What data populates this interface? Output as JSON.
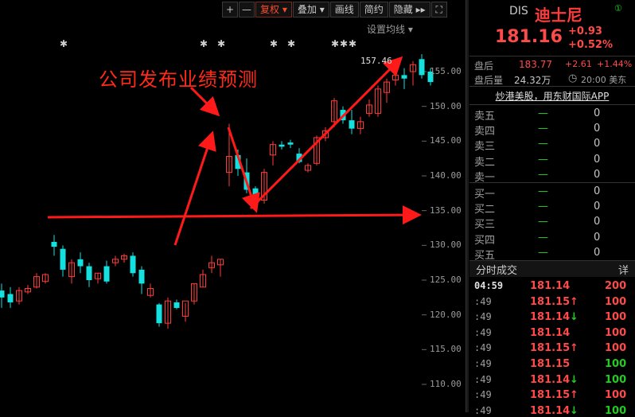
{
  "toolbar": {
    "plus": "+",
    "minus": "—",
    "adjust": "复权",
    "overlay": "叠加",
    "draw": "画线",
    "simple": "简约",
    "hide": "隐藏",
    "dropdown_arrow": "▾",
    "expand_arrow": "▸▸",
    "fullscreen": "⛶"
  },
  "ma_setting": "设置均线 ▾",
  "annotation": "公司发布业绩预测",
  "peak_label": "157.46",
  "chart_data": {
    "type": "candlestick",
    "title": "",
    "ylim": [
      107,
      158.5
    ],
    "y_ticks": [
      "155.00",
      "150.00",
      "145.00",
      "140.00",
      "135.00",
      "130.00",
      "125.00",
      "120.00",
      "115.00",
      "110.00"
    ],
    "candles": [
      {
        "o": 123.5,
        "h": 124.5,
        "c": 122.5,
        "l": 121.0
      },
      {
        "o": 123.0,
        "h": 124.0,
        "c": 121.8,
        "l": 121.0
      },
      {
        "o": 122.0,
        "h": 124.0,
        "c": 123.5,
        "l": 121.5
      },
      {
        "o": 123.3,
        "h": 124.3,
        "c": 123.8,
        "l": 123.0
      },
      {
        "o": 124.0,
        "h": 126.0,
        "c": 125.5,
        "l": 123.8
      },
      {
        "o": 124.8,
        "h": 126.0,
        "c": 125.8,
        "l": 124.5
      },
      {
        "o": 130.5,
        "h": 131.5,
        "c": 129.8,
        "l": 128.5
      },
      {
        "o": 129.5,
        "h": 130.0,
        "c": 126.5,
        "l": 125.5
      },
      {
        "o": 125.5,
        "h": 128.0,
        "c": 127.5,
        "l": 124.5
      },
      {
        "o": 128.0,
        "h": 129.0,
        "c": 127.0,
        "l": 126.0
      },
      {
        "o": 127.0,
        "h": 127.5,
        "c": 125.0,
        "l": 124.0
      },
      {
        "o": 125.2,
        "h": 126.0,
        "c": 126.0,
        "l": 124.5
      },
      {
        "o": 127.0,
        "h": 127.8,
        "c": 124.8,
        "l": 124.5
      },
      {
        "o": 127.5,
        "h": 128.5,
        "c": 128.0,
        "l": 127.0
      },
      {
        "o": 128.0,
        "h": 128.8,
        "c": 128.5,
        "l": 127.5
      },
      {
        "o": 128.5,
        "h": 129.0,
        "c": 126.0,
        "l": 125.5
      },
      {
        "o": 126.5,
        "h": 127.0,
        "c": 124.5,
        "l": 123.0
      },
      {
        "o": 122.8,
        "h": 124.5,
        "c": 123.8,
        "l": 122.5
      },
      {
        "o": 121.5,
        "h": 121.7,
        "c": 118.8,
        "l": 118.3
      },
      {
        "o": 118.8,
        "h": 122.5,
        "c": 122.0,
        "l": 118.0
      },
      {
        "o": 121.8,
        "h": 122.2,
        "c": 121.0,
        "l": 120.8
      },
      {
        "o": 119.8,
        "h": 121.7,
        "c": 122.0,
        "l": 119.0
      },
      {
        "o": 122.0,
        "h": 124.5,
        "c": 124.5,
        "l": 121.5
      },
      {
        "o": 124.0,
        "h": 126.5,
        "c": 125.8,
        "l": 124.0
      },
      {
        "o": 126.8,
        "h": 128.5,
        "c": 127.5,
        "l": 126.0
      },
      {
        "o": 127.2,
        "h": 128.0,
        "c": 128.0,
        "l": 125.5
      },
      {
        "o": 140.5,
        "h": 147.5,
        "c": 142.8,
        "l": 138.5
      },
      {
        "o": 143.0,
        "h": 143.8,
        "c": 141.0,
        "l": 140.0
      },
      {
        "o": 140.5,
        "h": 142.5,
        "c": 138.0,
        "l": 137.5
      },
      {
        "o": 138.2,
        "h": 138.5,
        "c": 136.2,
        "l": 135.8
      },
      {
        "o": 136.5,
        "h": 141.0,
        "c": 140.5,
        "l": 136.0
      },
      {
        "o": 143.0,
        "h": 145.0,
        "c": 144.5,
        "l": 141.5
      },
      {
        "o": 144.5,
        "h": 145.0,
        "c": 144.2,
        "l": 143.8
      },
      {
        "o": 144.8,
        "h": 145.2,
        "c": 144.5,
        "l": 144.0
      },
      {
        "o": 143.2,
        "h": 144.0,
        "c": 142.0,
        "l": 141.8
      },
      {
        "o": 140.8,
        "h": 141.8,
        "c": 141.5,
        "l": 140.5
      },
      {
        "o": 141.8,
        "h": 145.8,
        "c": 145.5,
        "l": 141.5
      },
      {
        "o": 145.5,
        "h": 147.0,
        "c": 146.5,
        "l": 145.0
      },
      {
        "o": 147.8,
        "h": 151.2,
        "c": 150.8,
        "l": 147.0
      },
      {
        "o": 149.5,
        "h": 150.0,
        "c": 148.0,
        "l": 147.5
      },
      {
        "o": 148.0,
        "h": 149.5,
        "c": 146.8,
        "l": 146.0
      },
      {
        "o": 146.8,
        "h": 148.5,
        "c": 147.8,
        "l": 146.0
      },
      {
        "o": 149.0,
        "h": 151.0,
        "c": 150.2,
        "l": 148.5
      },
      {
        "o": 149.0,
        "h": 153.0,
        "c": 152.5,
        "l": 148.5
      },
      {
        "o": 152.0,
        "h": 154.0,
        "c": 153.5,
        "l": 150.5
      },
      {
        "o": 153.8,
        "h": 155.0,
        "c": 154.5,
        "l": 153.0
      },
      {
        "o": 154.5,
        "h": 155.5,
        "c": 154.0,
        "l": 152.5
      },
      {
        "o": 155.0,
        "h": 156.5,
        "c": 156.0,
        "l": 153.0
      },
      {
        "o": 156.8,
        "h": 157.5,
        "c": 154.5,
        "l": 154.0
      },
      {
        "o": 155.0,
        "h": 155.5,
        "c": 153.5,
        "l": 153.0
      }
    ],
    "stars_at_candle": [
      7,
      23,
      25,
      31,
      33,
      38,
      39,
      40
    ]
  },
  "side": {
    "ticker": "DIS",
    "name": "迪士尼",
    "info_icon": "①",
    "price": "181.16",
    "chg_abs": "+0.93",
    "chg_pct": "+0.52%",
    "after_label": "盘后",
    "after_price": "183.77",
    "after_chg": "+2.61",
    "after_pct": "+1.44%",
    "after_vol_label": "盘后量",
    "after_vol": "24.32万",
    "clock_icon": "◷",
    "time": "20:00 美东",
    "ad": "炒港美股，用东财国际APP",
    "order_book": [
      {
        "label": "卖五",
        "dash": "—",
        "qty": "0"
      },
      {
        "label": "卖四",
        "dash": "—",
        "qty": "0"
      },
      {
        "label": "卖三",
        "dash": "—",
        "qty": "0"
      },
      {
        "label": "卖二",
        "dash": "—",
        "qty": "0"
      },
      {
        "label": "卖一",
        "dash": "—",
        "qty": "0"
      },
      {
        "label": "买一",
        "dash": "—",
        "qty": "0"
      },
      {
        "label": "买二",
        "dash": "—",
        "qty": "0"
      },
      {
        "label": "买三",
        "dash": "—",
        "qty": "0"
      },
      {
        "label": "买四",
        "dash": "—",
        "qty": "0"
      },
      {
        "label": "买五",
        "dash": "—",
        "qty": "0"
      }
    ],
    "trades_title": "分时成交",
    "trades_detail": "详",
    "trades": [
      {
        "t": "04:59",
        "p": "181.14",
        "a": "",
        "v": "200",
        "dir": "up"
      },
      {
        "t": ":49",
        "p": "181.15",
        "a": "↑",
        "v": "100",
        "dir": "up"
      },
      {
        "t": ":49",
        "p": "181.14",
        "a": "↓",
        "v": "100",
        "dir": "up"
      },
      {
        "t": ":49",
        "p": "181.14",
        "a": "",
        "v": "100",
        "dir": "up"
      },
      {
        "t": ":49",
        "p": "181.15",
        "a": "↑",
        "v": "100",
        "dir": "up"
      },
      {
        "t": ":49",
        "p": "181.15",
        "a": "",
        "v": "100",
        "dir": "down"
      },
      {
        "t": ":49",
        "p": "181.14",
        "a": "↓",
        "v": "100",
        "dir": "down"
      },
      {
        "t": ":49",
        "p": "181.15",
        "a": "↑",
        "v": "100",
        "dir": "up"
      },
      {
        "t": ":49",
        "p": "181.14",
        "a": "↓",
        "v": "100",
        "dir": "down"
      }
    ]
  },
  "colors": {
    "up": "#ff3b3b",
    "down": "#14e0e0",
    "arrow": "#ff1a1a",
    "green": "#22cc22"
  }
}
